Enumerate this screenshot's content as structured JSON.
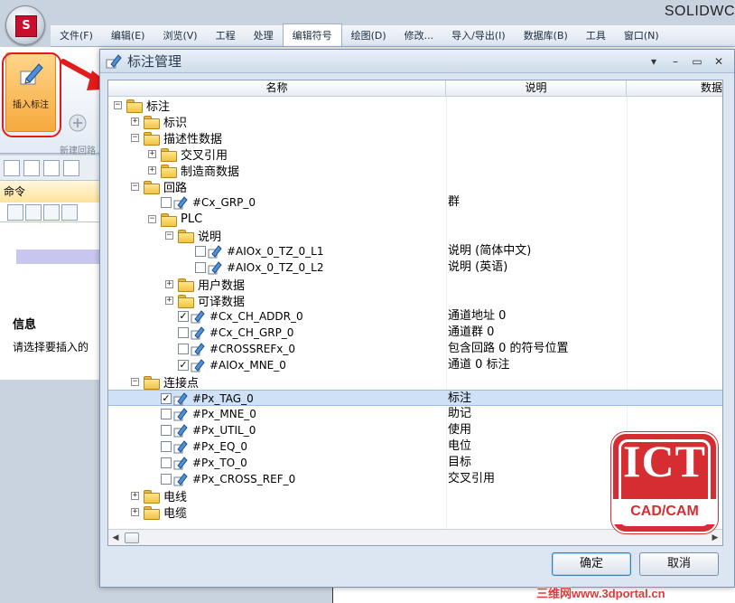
{
  "app": {
    "logo_text": "S",
    "title": "SOLIDWC"
  },
  "menu": [
    "文件(F)",
    "编辑(E)",
    "浏览(V)",
    "工程",
    "处理",
    "编辑符号",
    "绘图(D)",
    "修改...",
    "导入/导出(I)",
    "数据库(B)",
    "工具",
    "窗口(N)"
  ],
  "menu_active_index": 5,
  "ribbon": {
    "insert_tag_label": "插入标注",
    "new_circuit_label": "新建回路"
  },
  "left_panel": {
    "command_header": "命令",
    "info_title": "信息",
    "info_text": "请选择要插入的"
  },
  "dialog": {
    "title": "标注管理",
    "columns": [
      "名称",
      "说明",
      "数据"
    ],
    "ok_label": "确定",
    "cancel_label": "取消",
    "rows": [
      {
        "depth": 0,
        "exp": "-",
        "kind": "folder",
        "label": "标注"
      },
      {
        "depth": 1,
        "exp": "+",
        "kind": "folder",
        "label": "标识"
      },
      {
        "depth": 1,
        "exp": "-",
        "kind": "folder",
        "label": "描述性数据"
      },
      {
        "depth": 2,
        "exp": "+",
        "kind": "folder",
        "label": "交叉引用"
      },
      {
        "depth": 2,
        "exp": "+",
        "kind": "folder",
        "label": "制造商数据"
      },
      {
        "depth": 1,
        "exp": "-",
        "kind": "folder",
        "label": "回路"
      },
      {
        "depth": 2,
        "exp": "",
        "kind": "tag",
        "checked": false,
        "label": "#Cx_GRP_0",
        "desc": "群"
      },
      {
        "depth": 2,
        "exp": "-",
        "kind": "folder",
        "label": "PLC"
      },
      {
        "depth": 3,
        "exp": "-",
        "kind": "folder",
        "label": "说明"
      },
      {
        "depth": 4,
        "exp": "",
        "kind": "tag",
        "checked": false,
        "label": "#AIOx_0_TZ_0_L1",
        "desc": "说明 (简体中文)"
      },
      {
        "depth": 4,
        "exp": "",
        "kind": "tag",
        "checked": false,
        "label": "#AIOx_0_TZ_0_L2",
        "desc": "说明 (英语)"
      },
      {
        "depth": 3,
        "exp": "+",
        "kind": "folder",
        "label": "用户数据"
      },
      {
        "depth": 3,
        "exp": "+",
        "kind": "folder",
        "label": "可译数据"
      },
      {
        "depth": 3,
        "exp": "",
        "kind": "tag",
        "checked": true,
        "label": "#Cx_CH_ADDR_0",
        "desc": "通道地址 0"
      },
      {
        "depth": 3,
        "exp": "",
        "kind": "tag",
        "checked": false,
        "label": "#Cx_CH_GRP_0",
        "desc": "通道群 0"
      },
      {
        "depth": 3,
        "exp": "",
        "kind": "tag",
        "checked": false,
        "label": "#CROSSREFx_0",
        "desc": "包含回路 0 的符号位置"
      },
      {
        "depth": 3,
        "exp": "",
        "kind": "tag",
        "checked": true,
        "label": "#AIOx_MNE_0",
        "desc": "通道 0 标注"
      },
      {
        "depth": 1,
        "exp": "-",
        "kind": "folder",
        "label": "连接点"
      },
      {
        "depth": 2,
        "exp": "",
        "kind": "tag",
        "checked": true,
        "selected": true,
        "label": "#Px_TAG_0",
        "desc": "标注"
      },
      {
        "depth": 2,
        "exp": "",
        "kind": "tag",
        "checked": false,
        "label": "#Px_MNE_0",
        "desc": "助记"
      },
      {
        "depth": 2,
        "exp": "",
        "kind": "tag",
        "checked": false,
        "label": "#Px_UTIL_0",
        "desc": "使用"
      },
      {
        "depth": 2,
        "exp": "",
        "kind": "tag",
        "checked": false,
        "label": "#Px_EQ_0",
        "desc": "电位"
      },
      {
        "depth": 2,
        "exp": "",
        "kind": "tag",
        "checked": false,
        "label": "#Px_TO_0",
        "desc": "目标"
      },
      {
        "depth": 2,
        "exp": "",
        "kind": "tag",
        "checked": false,
        "label": "#Px_CROSS_REF_0",
        "desc": "交叉引用"
      },
      {
        "depth": 1,
        "exp": "+",
        "kind": "folder",
        "label": "电线"
      },
      {
        "depth": 1,
        "exp": "+",
        "kind": "folder",
        "label": "电缆"
      }
    ]
  },
  "watermark": {
    "logo_big": "ICT",
    "logo_small": "CAD/CAM",
    "site": "三维网www.3dportal.cn"
  },
  "colors": {
    "highlight_red": "#e21b1b",
    "selection": "#cfe1f7",
    "ribbon_orange": "#f6a93d"
  }
}
